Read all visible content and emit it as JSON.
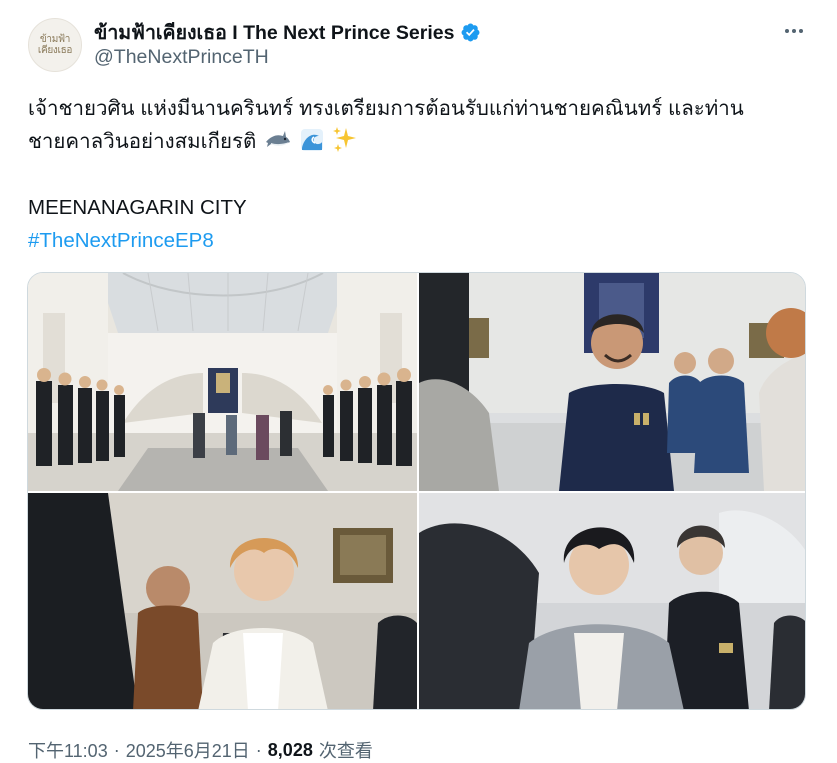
{
  "author": {
    "display_name": "ข้ามฟ้าเคียงเธอ I The Next Prince Series",
    "handle": "@TheNextPrinceTH",
    "avatar_text": "ข้ามฟ้า เคียงเธอ",
    "verified": true
  },
  "tweet": {
    "line1": "เจ้าชายวศิน แห่งมีนานครินทร์ ทรงเตรียมการต้อนรับแก่ท่านชายคณินทร์ และท่าน",
    "line2": "ชายคาลวินอย่างสมเกียรติ",
    "emojis": [
      "shark-emoji",
      "wave-emoji",
      "sparkles-emoji"
    ],
    "line3": "MEENANAGARIN CITY",
    "hashtag": "#TheNextPrinceEP8"
  },
  "media": {
    "photos": [
      "palace-hall-photo",
      "smiling-man-photo",
      "blond-prince-photo",
      "dark-haired-prince-photo"
    ]
  },
  "footer": {
    "time": "下午11:03",
    "date": "2025年6月21日",
    "views_count": "8,028",
    "views_label": "次查看"
  },
  "colors": {
    "accent": "#1d9bf0",
    "secondary_text": "#536471",
    "primary_text": "#0f1419"
  }
}
